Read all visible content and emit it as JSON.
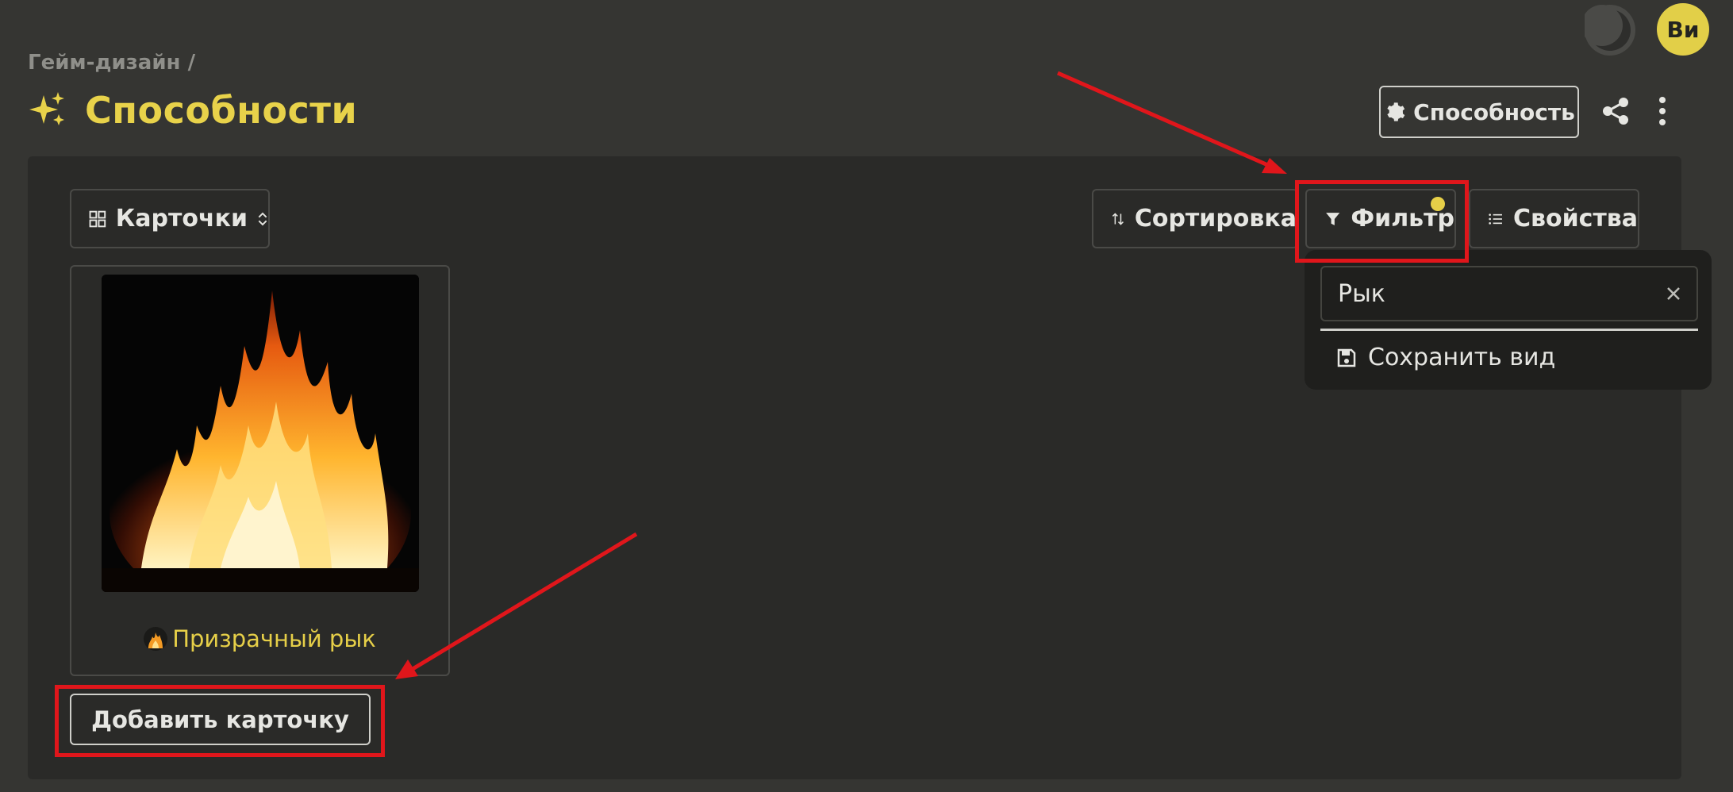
{
  "header": {
    "breadcrumb": "Гейм-дизайн /",
    "title": "Способности",
    "type_button_label": "Способность",
    "avatar_initials": "Ви"
  },
  "toolbar": {
    "view_label": "Карточки",
    "sort_label": "Сортировка",
    "filter_label": "Фильтр",
    "properties_label": "Свойства"
  },
  "filter_popup": {
    "input_value": "Рык",
    "save_view_label": "Сохранить вид"
  },
  "cards": [
    {
      "title": "Призрачный рык"
    }
  ],
  "add_card_label": "Добавить карточку",
  "colors": {
    "background": "#353532",
    "panel": "#2a2a28",
    "accent": "#e8d24a",
    "annotation": "#e0161b"
  },
  "icons": [
    "sparkles-icon",
    "gear-icon",
    "share-icon",
    "more-vertical-icon",
    "grid-icon",
    "sort-icon",
    "filter-icon",
    "list-icon",
    "close-icon",
    "save-icon",
    "moon-icon",
    "fire-icon"
  ]
}
